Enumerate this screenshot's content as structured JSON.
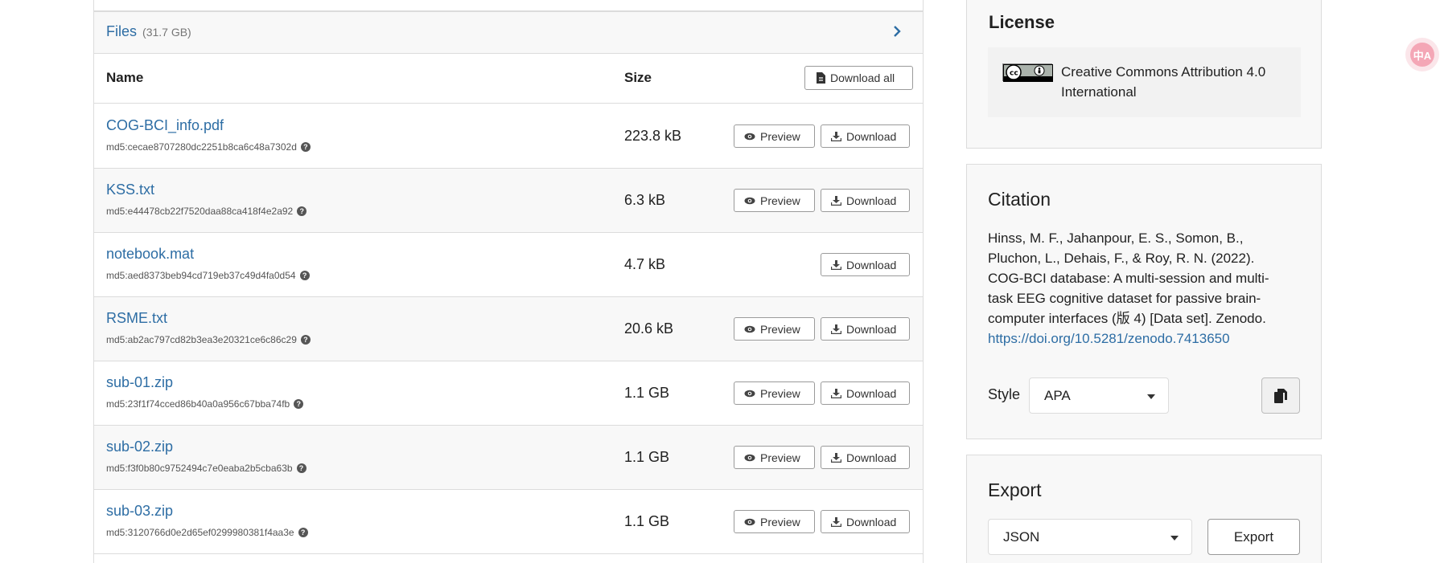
{
  "files": {
    "title": "Files",
    "total_size": "(31.7 GB)",
    "columns": {
      "name": "Name",
      "size": "Size"
    },
    "download_all_label": "Download all",
    "preview_label": "Preview",
    "download_label": "Download",
    "rows": [
      {
        "name": "COG-BCI_info.pdf",
        "md5": "md5:cecae8707280dc2251b8ca6c48a7302d",
        "size": "223.8 kB",
        "has_preview": true
      },
      {
        "name": "KSS.txt",
        "md5": "md5:e44478cb22f7520daa88ca418f4e2a92",
        "size": "6.3 kB",
        "has_preview": true
      },
      {
        "name": "notebook.mat",
        "md5": "md5:aed8373beb94cd719eb37c49d4fa0d54",
        "size": "4.7 kB",
        "has_preview": false
      },
      {
        "name": "RSME.txt",
        "md5": "md5:ab2ac797cd82b3ea3e20321ce6c86c29",
        "size": "20.6 kB",
        "has_preview": true
      },
      {
        "name": "sub-01.zip",
        "md5": "md5:23f1f74cced86b40a0a956c67bba74fb",
        "size": "1.1 GB",
        "has_preview": true
      },
      {
        "name": "sub-02.zip",
        "md5": "md5:f3f0b80c9752494c7e0eaba2b5cba63b",
        "size": "1.1 GB",
        "has_preview": true
      },
      {
        "name": "sub-03.zip",
        "md5": "md5:3120766d0e2d65ef0299980381f4aa3e",
        "size": "1.1 GB",
        "has_preview": true
      }
    ]
  },
  "license": {
    "title": "License",
    "name": "Creative Commons Attribution 4.0 International",
    "badge_text": "cc by"
  },
  "citation": {
    "title": "Citation",
    "text": "Hinss, M. F., Jahanpour, E. S., Somon, B., Pluchon, L., Dehais, F., & Roy, R. N. (2022). COG-BCI database: A multi-session and multi-task EEG cognitive dataset for passive brain-computer interfaces (版 4) [Data set]. Zenodo.",
    "doi": "https://doi.org/10.5281/zenodo.7413650",
    "style_label": "Style",
    "style_value": "APA"
  },
  "export": {
    "title": "Export",
    "format_value": "JSON",
    "button_label": "Export"
  },
  "translate_icon_text": "中A",
  "colors": {
    "link": "#2d6da4",
    "panel_bg": "#f8f8f8",
    "border": "#dcdcdc"
  }
}
